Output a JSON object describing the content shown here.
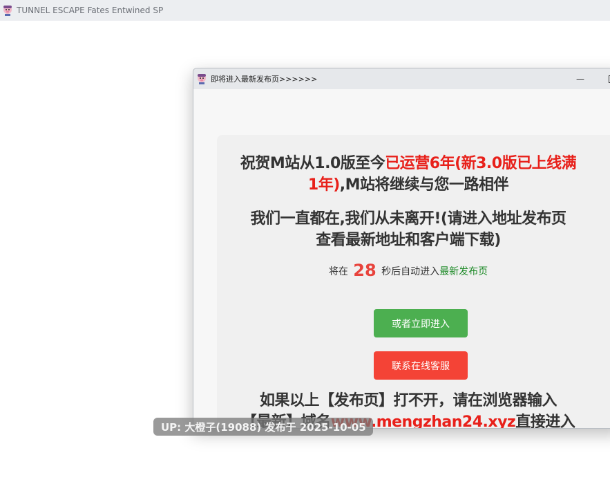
{
  "app": {
    "title": "TUNNEL ESCAPE Fates Entwined SP",
    "icon": "pig-icon"
  },
  "popup": {
    "title": "即将进入最新发布页>>>>>>",
    "icon": "pig-icon",
    "minimize_label": "—"
  },
  "content": {
    "line1_part1": "祝贺M站从1.0版至今",
    "line1_part2_red": "已运营6年(新3.0版已上线满",
    "line2_red": "1年)",
    "line2_rest": ",M站将继续与您一路相伴",
    "line3": "我们一直都在,我们从未离开!(请进入地址发布页",
    "line4": "查看最新地址和客户端下载)",
    "countdown_prefix": "将在",
    "countdown_number": "28",
    "countdown_suffix": "秒后自动进入",
    "countdown_link": "最新发布页",
    "enter_button": "或者立即进入",
    "support_button": "联系在线客服",
    "line5": "如果以上【发布页】打不开，请在浏览器输入",
    "line6_part1": "【最新】域名",
    "line6_url": "www.mengzhan24.xyz",
    "line6_part2": "直接进入"
  },
  "watermark": "UP: 大橙子(19088) 发布于 2025-10-05",
  "colors": {
    "accent_red": "#e8201a",
    "countdown_red": "#e8433c",
    "link_green": "#1d8a27",
    "button_green": "#4caf50",
    "button_red": "#f44336"
  }
}
